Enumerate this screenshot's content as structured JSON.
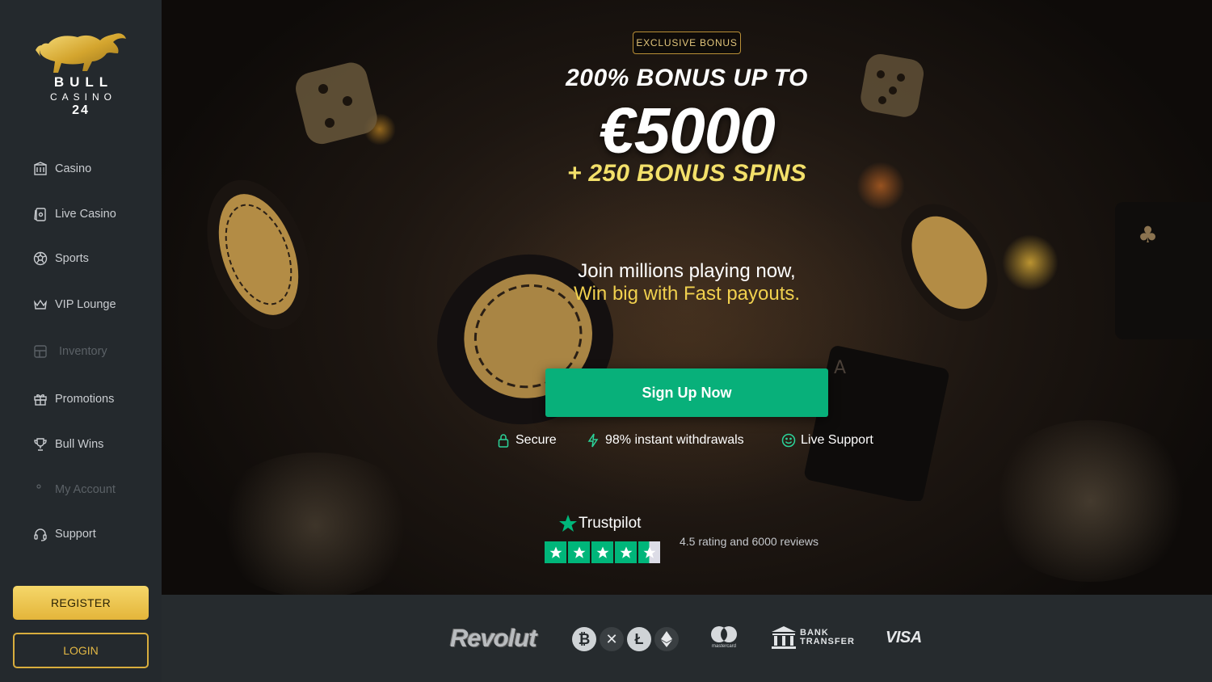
{
  "brand": {
    "line1": "BULL",
    "line2": "CASINO",
    "line3": "24",
    "logo_icon": "golden-bull-icon"
  },
  "sidebar": {
    "items": [
      {
        "label": "Casino",
        "icon": "casino-building-icon",
        "enabled": true
      },
      {
        "label": "Live Casino",
        "icon": "cards-icon",
        "enabled": true
      },
      {
        "label": "Sports",
        "icon": "soccer-ball-icon",
        "enabled": true
      },
      {
        "label": "VIP Lounge",
        "icon": "crown-icon",
        "enabled": true
      },
      {
        "label": "Inventory",
        "icon": "inventory-icon",
        "enabled": false
      },
      {
        "label": "Promotions",
        "icon": "gift-icon",
        "enabled": true
      },
      {
        "label": "Bull Wins",
        "icon": "trophy-icon",
        "enabled": true
      },
      {
        "label": "My Account",
        "icon": "user-icon",
        "enabled": false
      },
      {
        "label": "Support",
        "icon": "headset-icon",
        "enabled": true
      }
    ],
    "register_label": "REGISTER",
    "login_label": "LOGIN"
  },
  "hero": {
    "badge": "EXCLUSIVE BONUS",
    "headline_1": "200% BONUS UP TO",
    "headline_amount": "€5000",
    "headline_3": "+ 250 BONUS SPINS",
    "tagline_1": "Join millions playing now,",
    "tagline_2": "Win big with Fast payouts.",
    "cta_label": "Sign Up Now",
    "features": [
      {
        "label": "Secure",
        "icon": "lock-icon"
      },
      {
        "label": "98% instant withdrawals",
        "icon": "lightning-icon"
      },
      {
        "label": "Live Support",
        "icon": "smiley-icon"
      }
    ],
    "trustpilot": {
      "brand": "Trustpilot",
      "rating": 4.5,
      "text": "4.5 rating and 6000 reviews"
    }
  },
  "payments": {
    "revolut": "Revolut",
    "crypto": [
      "bitcoin-icon",
      "xrp-icon",
      "litecoin-icon",
      "ethereum-icon"
    ],
    "mastercard_label": "mastercard",
    "bank_line1": "BANK",
    "bank_line2": "TRANSFER",
    "visa": "VISA"
  },
  "colors": {
    "accent_gold": "#e4b53a",
    "cta_green": "#08b07a",
    "trustpilot_green": "#00b67a",
    "sidebar_bg": "#24292d",
    "payments_bg": "#262b2e"
  }
}
